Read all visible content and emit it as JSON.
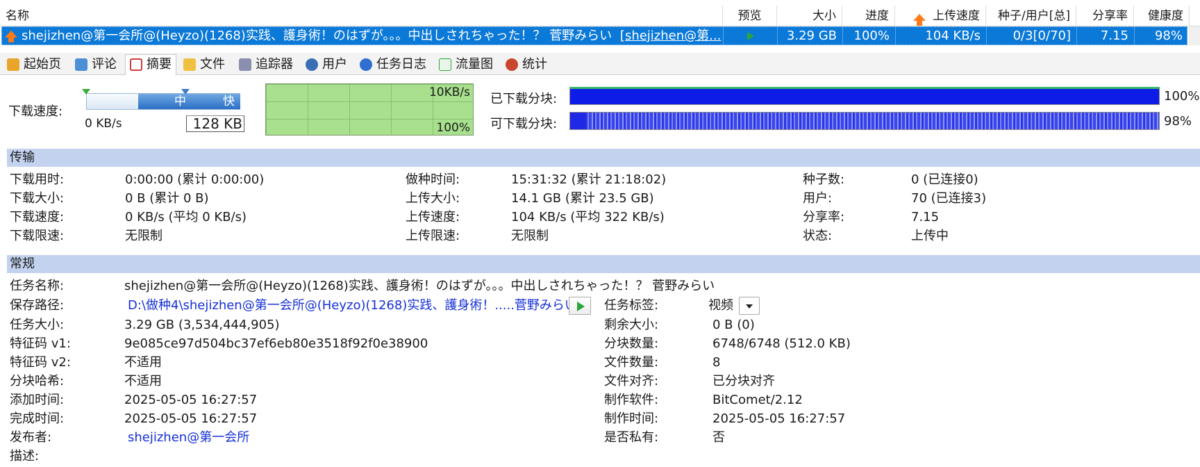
{
  "list": {
    "columns": [
      "名称",
      "预览",
      "大小",
      "进度",
      "上传速度",
      "种子/用户[总]",
      "分享率",
      "健康度"
    ],
    "row": {
      "name": "shejizhen@第一会所@(Heyzo)(1268)实践、護身術！のはずが。。。中出しされちゃった！？ 菅野みらい",
      "name_link": "[shejizhen@第...",
      "size": "3.29 GB",
      "progress": "100%",
      "upload_speed": "104 KB/s",
      "seeds_peers": "0/3[0/70]",
      "share_ratio": "7.15",
      "health": "98%"
    }
  },
  "tabs": [
    {
      "label": "起始页",
      "icon": "start-page-icon",
      "color": "#e8a52a"
    },
    {
      "label": "评论",
      "icon": "comment-icon",
      "color": "#4d8fd6"
    },
    {
      "label": "摘要",
      "icon": "summary-icon",
      "color": "#d23a3a"
    },
    {
      "label": "文件",
      "icon": "files-icon",
      "color": "#f0c040"
    },
    {
      "label": "追踪器",
      "icon": "tracker-icon",
      "color": "#8a8fb0"
    },
    {
      "label": "用户",
      "icon": "peers-icon",
      "color": "#3a6fb5"
    },
    {
      "label": "任务日志",
      "icon": "task-log-icon",
      "color": "#2f6fcf"
    },
    {
      "label": "流量图",
      "icon": "traffic-graph-icon",
      "color": "#2aa63a"
    },
    {
      "label": "统计",
      "icon": "stats-icon",
      "color": "#c9462e"
    }
  ],
  "speed": {
    "label": "下载速度:",
    "mid_label": "中",
    "fast_label": "快",
    "current": "0 KB/s",
    "limit": "128 KB",
    "graph_top": "10KB/s",
    "graph_bottom": "100%"
  },
  "pieces": {
    "downloaded_label": "已下载分块:",
    "downloaded_pct": "100%",
    "available_label": "可下载分块:",
    "available_pct": "98%"
  },
  "transfer": {
    "title": "传输",
    "download_time_label": "下载用时:",
    "download_time": "0:00:00 (累计 0:00:00)",
    "download_size_label": "下载大小:",
    "download_size": "0 B (累计 0 B)",
    "download_speed_label": "下载速度:",
    "download_speed": "0 KB/s (平均 0 KB/s)",
    "download_limit_label": "下载限速:",
    "download_limit": "无限制",
    "seed_time_label": "做种时间:",
    "seed_time": "15:31:32 (累计 21:18:02)",
    "upload_size_label": "上传大小:",
    "upload_size": "14.1 GB (累计 23.5 GB)",
    "upload_speed_label": "上传速度:",
    "upload_speed": "104 KB/s (平均 322 KB/s)",
    "upload_limit_label": "上传限速:",
    "upload_limit": "无限制",
    "seeds_label": "种子数:",
    "seeds": "0 (已连接0)",
    "peers_label": "用户:",
    "peers": "70 (已连接3)",
    "ratio_label": "分享率:",
    "ratio": "7.15",
    "status_label": "状态:",
    "status": "上传中"
  },
  "general": {
    "title": "常规",
    "task_name_label": "任务名称:",
    "task_name": "shejizhen@第一会所@(Heyzo)(1268)实践、護身術！のはずが。。。中出しされちゃった！？ 菅野みらい",
    "save_path_label": "保存路径:",
    "save_path": "D:\\做种4\\shejizhen@第一会所@(Heyzo)(1268)实践、護身術！.....菅野みらい",
    "task_size_label": "任务大小:",
    "task_size": "3.29 GB (3,534,444,905)",
    "hash_v1_label": "特征码 v1:",
    "hash_v1": "9e085ce97d504bc37ef6eb80e3518f92f0e38900",
    "hash_v2_label": "特征码 v2:",
    "hash_v2": "不适用",
    "piece_hash_label": "分块哈希:",
    "piece_hash": "不适用",
    "added_label": "添加时间:",
    "added": "2025-05-05 16:27:57",
    "completed_label": "完成时间:",
    "completed": "2025-05-05 16:27:57",
    "publisher_label": "发布者:",
    "publisher": "shejizhen@第一会所",
    "description_label": "描述:",
    "tag_label": "任务标签:",
    "tag": "视频",
    "remaining_label": "剩余大小:",
    "remaining": "0 B (0)",
    "piece_count_label": "分块数量:",
    "piece_count": "6748/6748 (512.0 KB)",
    "file_count_label": "文件数量:",
    "file_count": "8",
    "file_align_label": "文件对齐:",
    "file_align": "已分块对齐",
    "software_label": "制作软件:",
    "software": "BitComet/2.12",
    "created_label": "制作时间:",
    "created": "2025-05-05 16:27:57",
    "private_label": "是否私有:",
    "private": "否"
  }
}
